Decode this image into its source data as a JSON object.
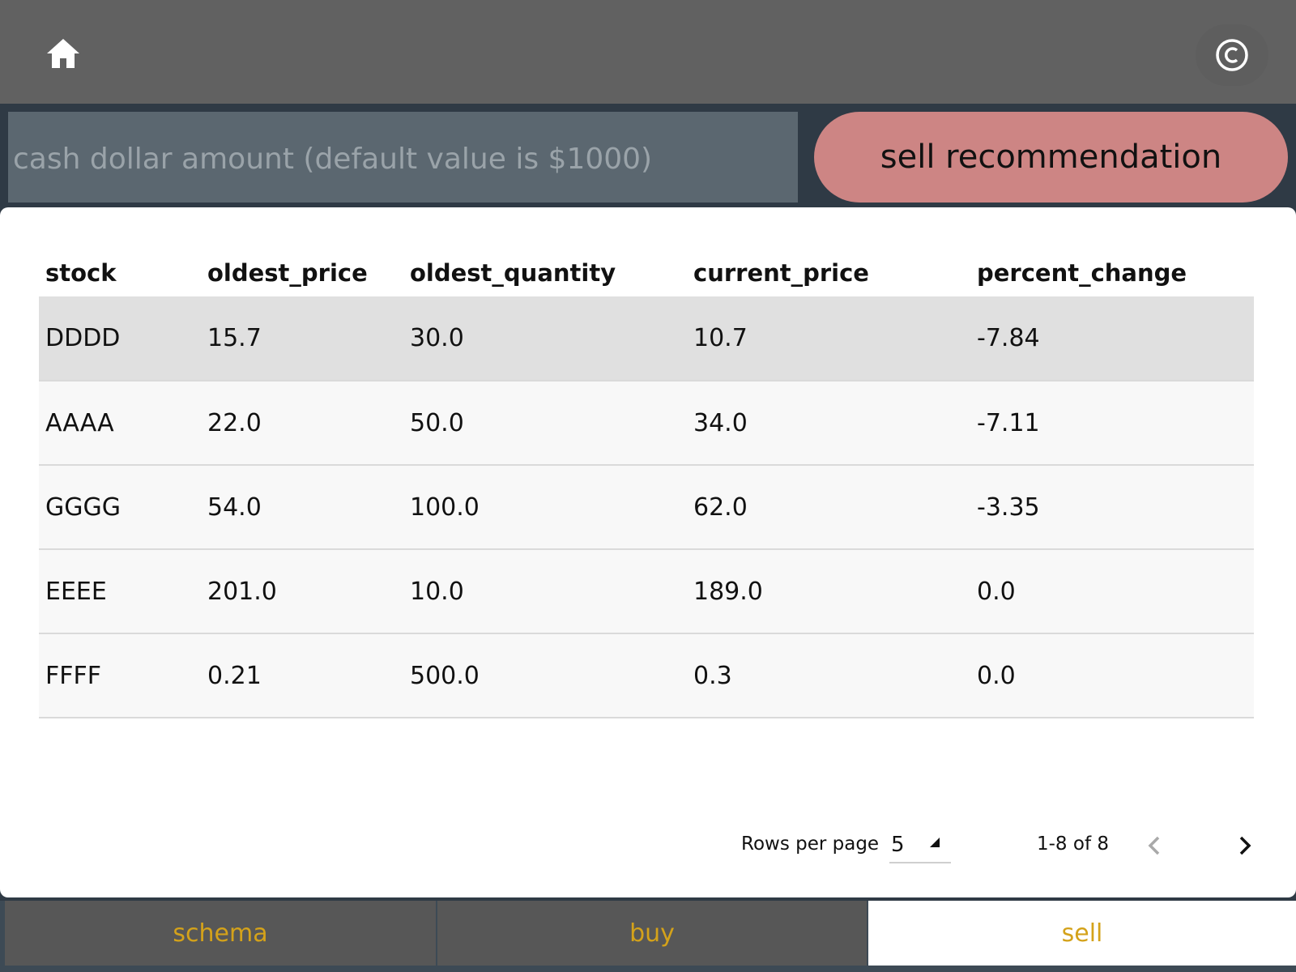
{
  "header": {
    "home_icon": "home-icon",
    "copyright_icon": "copyright-icon"
  },
  "controls": {
    "cash_placeholder": "cash dollar amount (default value is $1000)",
    "cash_value": "",
    "sell_button_label": "sell recommendation"
  },
  "table": {
    "columns": [
      "stock",
      "oldest_price",
      "oldest_quantity",
      "current_price",
      "percent_change"
    ],
    "rows": [
      [
        "DDDD",
        "15.7",
        "30.0",
        "10.7",
        "-7.84"
      ],
      [
        "AAAA",
        "22.0",
        "50.0",
        "34.0",
        "-7.11"
      ],
      [
        "GGGG",
        "54.0",
        "100.0",
        "62.0",
        "-3.35"
      ],
      [
        "EEEE",
        "201.0",
        "10.0",
        "189.0",
        "0.0"
      ],
      [
        "FFFF",
        "0.21",
        "500.0",
        "0.3",
        "0.0"
      ]
    ],
    "selected_row": 0
  },
  "pagination": {
    "rows_per_page_label": "Rows per page",
    "rows_per_page_value": "5",
    "range_text": "1-8 of 8",
    "prev_icon": "chevron-left-icon",
    "next_icon": "chevron-right-icon"
  },
  "tabs": [
    {
      "label": "schema",
      "active": false
    },
    {
      "label": "buy",
      "active": false
    },
    {
      "label": "sell",
      "active": true
    }
  ],
  "colors": {
    "topbar": "#616161",
    "sell_button": "#cd8584",
    "tab_text": "#d4a21a",
    "selected_row": "#e0e0e0"
  }
}
